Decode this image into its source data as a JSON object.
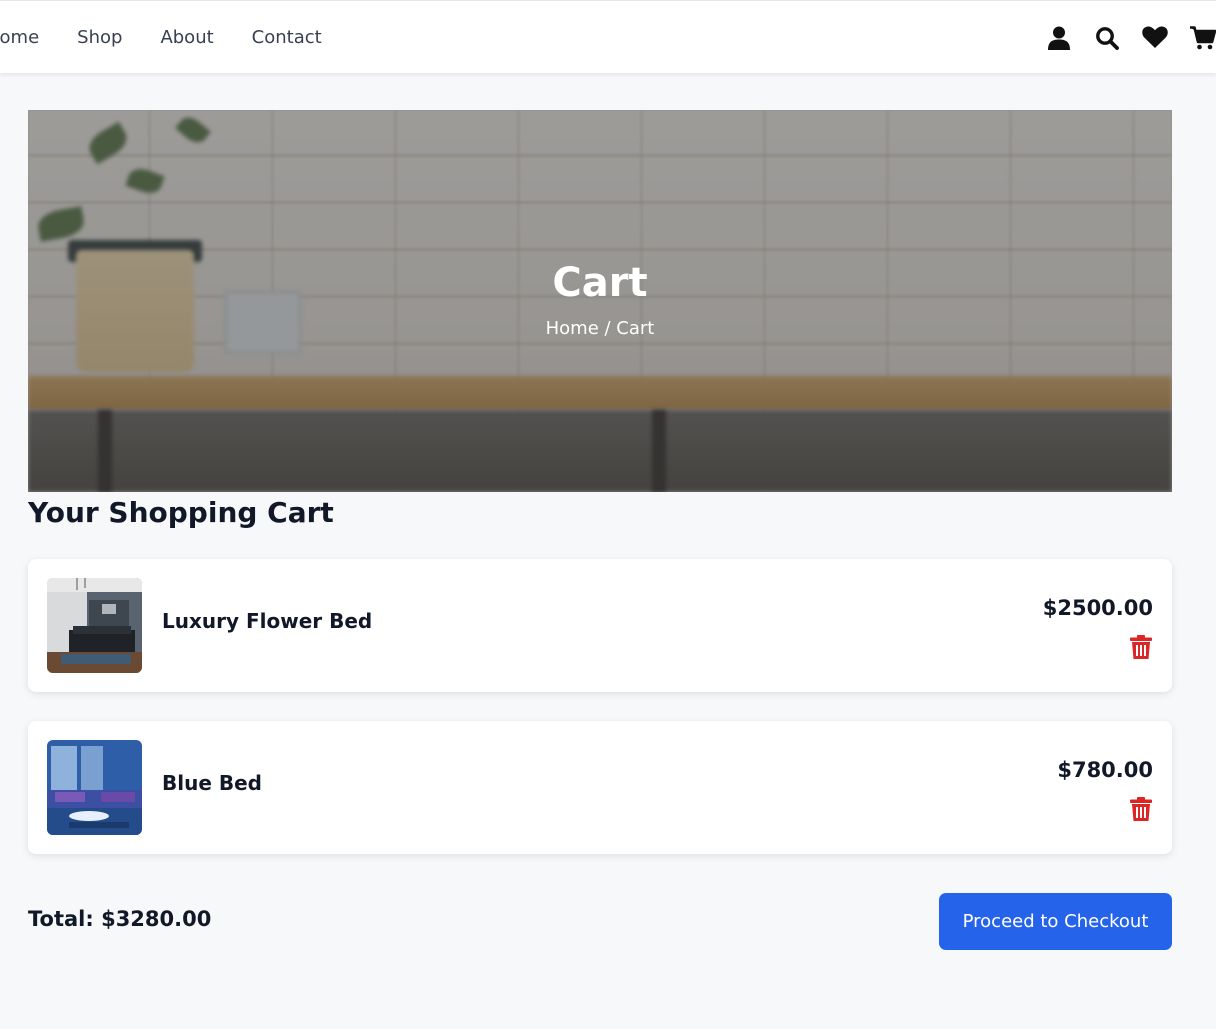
{
  "nav": {
    "links": [
      "Home",
      "Shop",
      "About",
      "Contact"
    ],
    "icons": [
      "user-icon",
      "search-icon",
      "heart-icon",
      "cart-icon"
    ]
  },
  "hero": {
    "title": "Cart",
    "breadcrumb": "Home / Cart"
  },
  "cart": {
    "heading": "Your Shopping Cart",
    "items": [
      {
        "name": "Luxury Flower Bed",
        "price": "$2500.00",
        "delete_icon": "trash-icon"
      },
      {
        "name": "Blue Bed",
        "price": "$780.00",
        "delete_icon": "trash-icon"
      }
    ],
    "total_label": "Total: $3280.00",
    "checkout_label": "Proceed to Checkout"
  },
  "colors": {
    "accent": "#2563eb",
    "danger": "#dc2626",
    "page_bg": "#f7f8fa",
    "text": "#111827"
  }
}
